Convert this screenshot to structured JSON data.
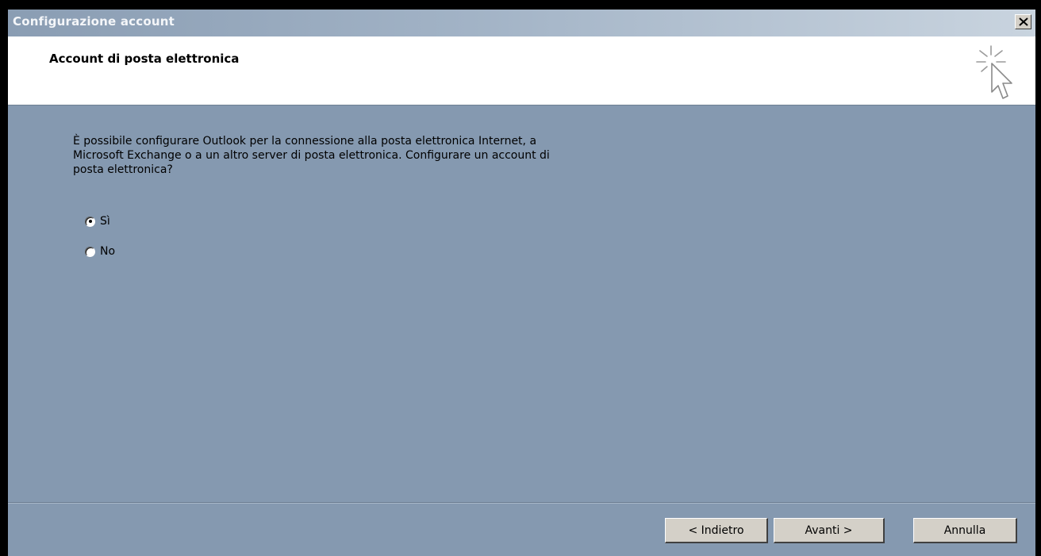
{
  "window": {
    "title": "Configurazione account"
  },
  "header": {
    "title": "Account di posta elettronica",
    "icon": "wizard-cursor-icon"
  },
  "content": {
    "question": "È possibile configurare Outlook per la connessione alla posta elettronica Internet, a\nMicrosoft Exchange o a un altro server di posta elettronica. Configurare un account di\nposta elettronica?",
    "options": [
      {
        "label": "Sì",
        "selected": true
      },
      {
        "label": "No",
        "selected": false
      }
    ]
  },
  "buttons": {
    "back": "< Indietro",
    "next": "Avanti >",
    "cancel": "Annulla"
  },
  "colors": {
    "dialog_background": "#8599b0",
    "header_background": "#ffffff",
    "button_face": "#d4d0c8"
  }
}
